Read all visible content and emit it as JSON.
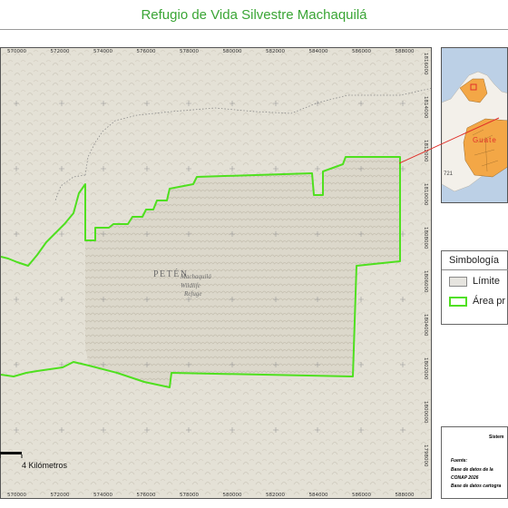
{
  "title": "Refugio de Vida Silvestre Machaquilá",
  "map": {
    "x_ticks": [
      "570000",
      "572000",
      "574000",
      "576000",
      "578000",
      "580000",
      "582000",
      "584000",
      "586000",
      "588000"
    ],
    "y_ticks": [
      "1816000",
      "1814000",
      "1812000",
      "1810000",
      "1808000",
      "1806000",
      "1804000",
      "1802000",
      "1800000",
      "1798000"
    ],
    "region_label": "PETÉN",
    "area_label_lines": [
      "Machaquilá",
      "Wildlife",
      "Refuge"
    ]
  },
  "inset": {
    "country_label": "Guate",
    "road_label": "721"
  },
  "legend": {
    "title": "Simbología",
    "items": [
      {
        "label": "Límite",
        "fill": "#e6e4df",
        "stroke": "#8a8a8a"
      },
      {
        "label": "Área pr",
        "fill": "#ffffff",
        "stroke": "#4fe01f"
      }
    ]
  },
  "info": {
    "system": "Sistem",
    "source_title": "Fuente:",
    "source_lines": [
      "Base de datos de la",
      "CONAP 2026",
      "Base de datos cartogra"
    ]
  },
  "scale_bar": {
    "label": "4 Kilómetros"
  },
  "colors": {
    "title": "#3aa535",
    "boundary": "#4fe01f",
    "terrain": "#e4e1d6",
    "inset_red": "#e0302a",
    "inset_orange": "#f3a746"
  }
}
